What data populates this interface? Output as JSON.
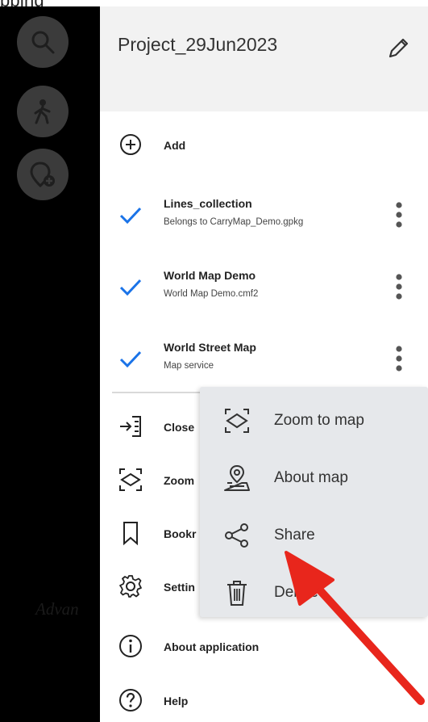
{
  "caption": "pping",
  "strip_text": "Advan",
  "project": {
    "title": "Project_29Jun2023"
  },
  "menu": {
    "add_label": "Add",
    "layers": [
      {
        "name": "Lines_collection",
        "subtitle": "Belongs to CarryMap_Demo.gpkg",
        "checked": true
      },
      {
        "name": "World Map Demo",
        "subtitle": "World Map Demo.cmf2",
        "checked": true
      },
      {
        "name": "World Street Map",
        "subtitle": "Map service",
        "checked": true
      }
    ],
    "items": [
      {
        "label": "Close",
        "icon": "close-map-icon"
      },
      {
        "label": "Zoom",
        "icon": "zoom-extent-icon"
      },
      {
        "label": "Bookr",
        "icon": "bookmark-icon"
      },
      {
        "label": "Settin",
        "icon": "gear-icon"
      },
      {
        "label": "About application",
        "icon": "info-icon"
      },
      {
        "label": "Help",
        "icon": "help-icon"
      }
    ]
  },
  "context_menu": {
    "items": [
      {
        "label": "Zoom to map",
        "icon": "zoom-to-map-icon"
      },
      {
        "label": "About map",
        "icon": "map-pin-icon"
      },
      {
        "label": "Share",
        "icon": "share-icon"
      },
      {
        "label": "Delete",
        "icon": "trash-icon"
      }
    ]
  },
  "colors": {
    "accent": "#1a73e8",
    "arrow": "#e8261c",
    "strip": "#000000",
    "fab": "#3b3b3b"
  }
}
